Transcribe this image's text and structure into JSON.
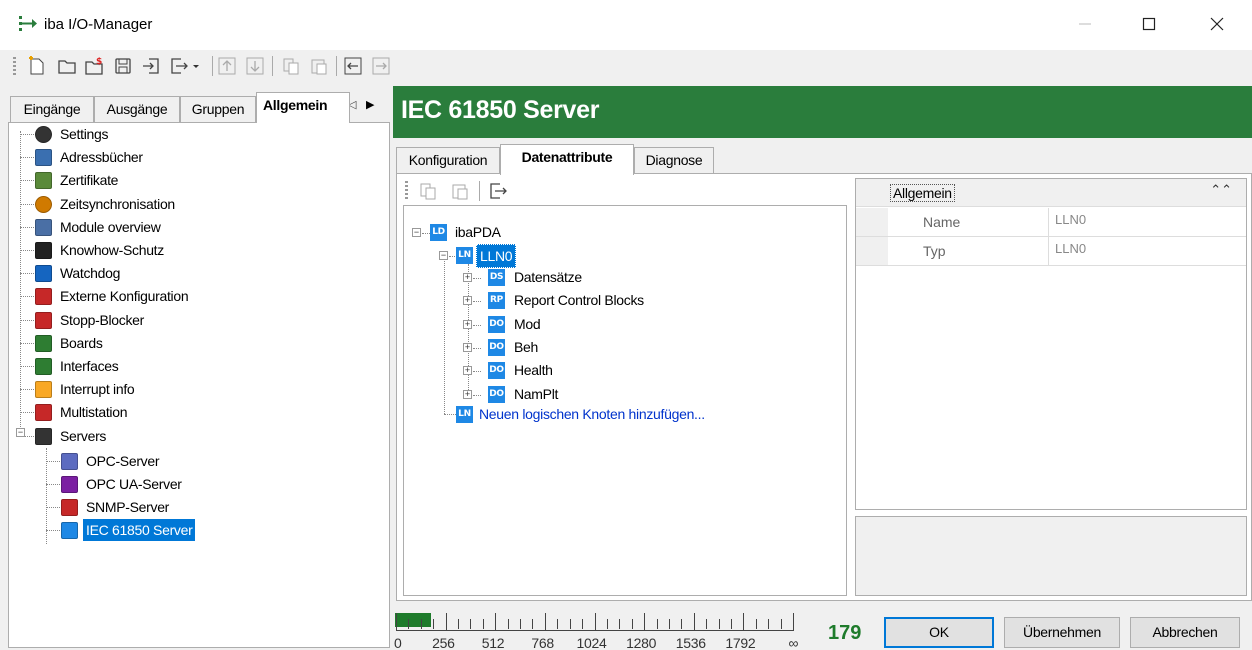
{
  "window": {
    "title": "iba I/O-Manager",
    "controls": [
      "minimize",
      "maximize",
      "close"
    ]
  },
  "toolbar": {
    "buttons": [
      "new-icon",
      "open-icon",
      "open-special-icon",
      "save-icon",
      "import-icon",
      "export-icon",
      "move-up-icon",
      "move-down-icon",
      "copy-icon",
      "paste-icon",
      "collapse-left-icon",
      "expand-right-icon"
    ]
  },
  "left_tabs": [
    {
      "label": "Eingänge",
      "active": false
    },
    {
      "label": "Ausgänge",
      "active": false
    },
    {
      "label": "Gruppen",
      "active": false
    },
    {
      "label": "Allgemein",
      "active": true
    }
  ],
  "tree": [
    {
      "label": "Settings",
      "icon": "gear-icon"
    },
    {
      "label": "Adressbücher",
      "icon": "address-book-icon"
    },
    {
      "label": "Zertifikate",
      "icon": "certificate-icon"
    },
    {
      "label": "Zeitsynchronisation",
      "icon": "clock-sync-icon"
    },
    {
      "label": "Module overview",
      "icon": "module-overview-icon"
    },
    {
      "label": "Knowhow-Schutz",
      "icon": "key-icon"
    },
    {
      "label": "Watchdog",
      "icon": "watchdog-icon"
    },
    {
      "label": "Externe Konfiguration",
      "icon": "external-config-icon"
    },
    {
      "label": "Stopp-Blocker",
      "icon": "stop-icon"
    },
    {
      "label": "Boards",
      "icon": "board-icon"
    },
    {
      "label": "Interfaces",
      "icon": "interfaces-icon"
    },
    {
      "label": "Interrupt info",
      "icon": "lightning-icon"
    },
    {
      "label": "Multistation",
      "icon": "multistation-icon"
    },
    {
      "label": "Servers",
      "icon": "network-icon"
    },
    {
      "label": "OPC-Server",
      "icon": "opc-icon"
    },
    {
      "label": "OPC UA-Server",
      "icon": "opc-ua-icon"
    },
    {
      "label": "SNMP-Server",
      "icon": "snmp-icon"
    },
    {
      "label": "IEC 61850 Server",
      "icon": "iec61850-icon",
      "selected": true
    }
  ],
  "panel": {
    "title": "IEC 61850 Server",
    "tabs": [
      {
        "label": "Konfiguration",
        "active": false
      },
      {
        "label": "Datenattribute",
        "active": true
      },
      {
        "label": "Diagnose",
        "active": false
      }
    ]
  },
  "ied_tree": {
    "root": {
      "tag": "LD",
      "label": "ibaPDA"
    },
    "node": {
      "tag": "LN",
      "label": "LLN0"
    },
    "children": [
      {
        "tag": "DS",
        "label": "Datensätze"
      },
      {
        "tag": "RP",
        "label": "Report Control Blocks"
      },
      {
        "tag": "DO",
        "label": "Mod"
      },
      {
        "tag": "DO",
        "label": "Beh"
      },
      {
        "tag": "DO",
        "label": "Health"
      },
      {
        "tag": "DO",
        "label": "NamPlt"
      }
    ],
    "add_link": {
      "tag": "LN",
      "label": "Neuen logischen Knoten hinzufügen..."
    }
  },
  "properties": {
    "category": "Allgemein",
    "rows": [
      {
        "name": "Name",
        "value": "LLN0"
      },
      {
        "name": "Typ",
        "value": "LLN0"
      }
    ]
  },
  "scale": {
    "labels": [
      "0",
      "256",
      "512",
      "768",
      "1024",
      "1280",
      "1536",
      "1792",
      "∞"
    ],
    "count": "179",
    "fill_fraction": 0.09
  },
  "buttons": {
    "ok": "OK",
    "apply": "Übernehmen",
    "cancel": "Abbrechen"
  },
  "colors": {
    "header_green": "#2a7d3c",
    "selection_blue": "#0078d7",
    "tag_blue": "#1e88e5",
    "link_blue": "#0033cc"
  }
}
